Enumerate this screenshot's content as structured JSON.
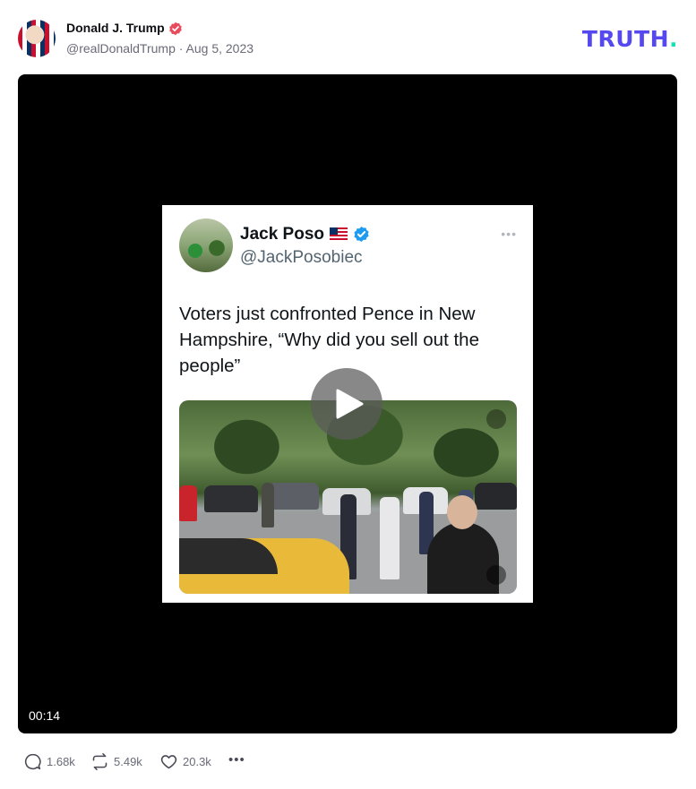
{
  "post": {
    "author_name": "Donald J. Trump",
    "author_handle_and_date": "@realDonaldTrump · Aug 5, 2023",
    "brand": {
      "text": "TRUTH",
      "dot": ".",
      "color": "#5448ee",
      "dot_color": "#17e0b5"
    },
    "verified_color": "#e74b5c"
  },
  "video": {
    "duration": "00:14",
    "embedded_tweet": {
      "name": "Jack Poso",
      "handle": "@JackPosobiec",
      "text": "Voters just confronted Pence in New Hampshire, “Why did you sell out the people”",
      "more": "•••"
    }
  },
  "actions": {
    "replies": "1.68k",
    "retruths": "5.49k",
    "likes": "20.3k",
    "more": "•••"
  }
}
